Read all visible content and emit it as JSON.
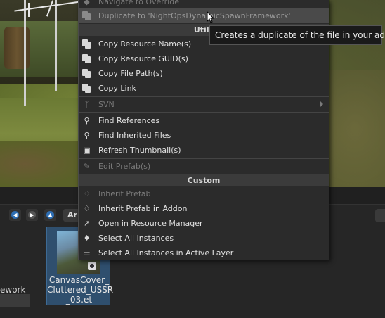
{
  "viewport": {
    "description_icon": "scene-view"
  },
  "browser": {
    "left_pane_label": "ework",
    "breadcrumb_label": "Ar",
    "asset": {
      "name": "CanvasCover_\nCluttered_USSR\n_03.et",
      "badge_icon": "lock-icon"
    }
  },
  "context_menu": {
    "partial_top": "Navigate to Override",
    "duplicate": "Duplicate to 'NightOpsDynamicSpawnFramework'",
    "utils_header": "Utils",
    "copy_resource_name": "Copy Resource Name(s)",
    "copy_resource_guid": "Copy Resource GUID(s)",
    "copy_file_path": "Copy File Path(s)",
    "copy_link": "Copy Link",
    "svn": "SVN",
    "find_references": "Find References",
    "find_inherited": "Find Inherited Files",
    "refresh_thumbnail": "Refresh Thumbnail(s)",
    "edit_prefab": "Edit Prefab(s)",
    "custom_header": "Custom",
    "inherit_prefab": "Inherit Prefab",
    "inherit_prefab_addon": "Inherit Prefab in Addon",
    "open_resource_manager": "Open in Resource Manager",
    "select_all_instances": "Select All Instances",
    "select_all_active_layer": "Select All Instances in Active Layer"
  },
  "tooltip": {
    "text": "Creates a duplicate of the file in your addon"
  },
  "colors": {
    "accent": "#2f4f6e",
    "menu_bg": "#2b2b2b",
    "nav_blue": "#2e6fb5"
  }
}
